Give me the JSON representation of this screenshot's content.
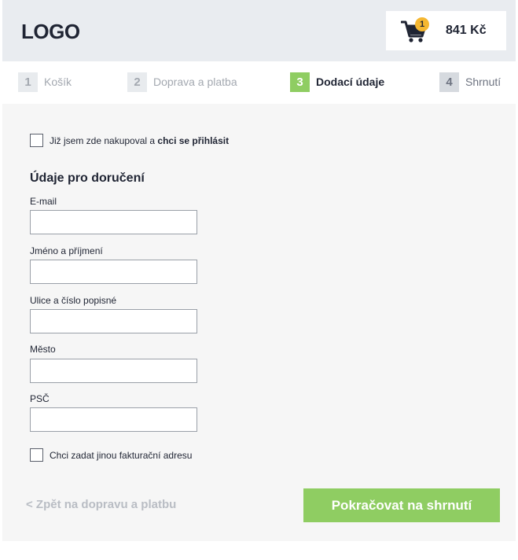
{
  "header": {
    "logo": "LOGO",
    "cart": {
      "icon": "shopping-cart-icon",
      "count": "1",
      "price": "841 Kč"
    }
  },
  "steps": [
    {
      "number": "1",
      "label": "Košík",
      "state": "inactive"
    },
    {
      "number": "2",
      "label": "Doprava a platba",
      "state": "inactive"
    },
    {
      "number": "3",
      "label": "Dodací údaje",
      "state": "active"
    },
    {
      "number": "4",
      "label": "Shrnutí",
      "state": "inactive"
    }
  ],
  "login": {
    "text": "Již jsem zde nakupoval a ",
    "bold": "chci se přihlásit"
  },
  "form": {
    "title": "Údaje pro doručení",
    "fields": [
      {
        "label": "E-mail",
        "value": ""
      },
      {
        "label": "Jméno a příjmení",
        "value": ""
      },
      {
        "label": "Ulice a číslo popisné",
        "value": ""
      },
      {
        "label": "Město",
        "value": ""
      },
      {
        "label": "PSČ",
        "value": ""
      }
    ],
    "billing_checkbox": "Chci zadat jinou fakturační adresu"
  },
  "actions": {
    "back": "< Zpět na dopravu a platbu",
    "continue": "Pokračovat na shrnutí"
  },
  "colors": {
    "accent": "#8fcd62",
    "badge": "#f5b731",
    "header_bg": "#e9ecf0",
    "content_bg": "#f6f6f6",
    "text": "#1f2433"
  }
}
